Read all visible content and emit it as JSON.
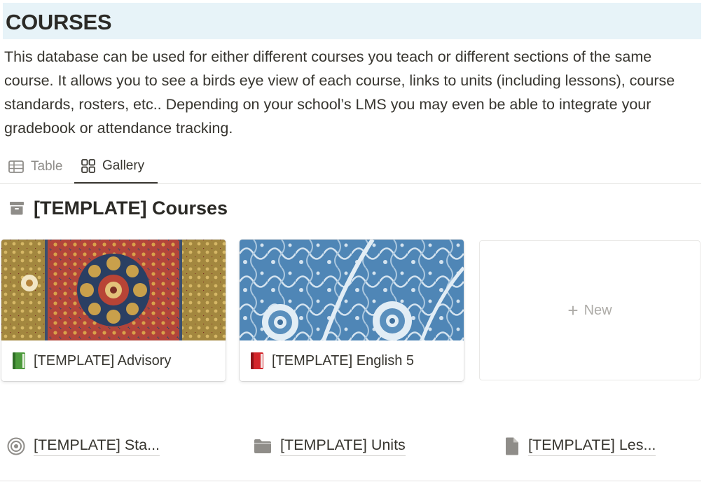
{
  "page": {
    "heading": "COURSES",
    "description": "This database can be used for either different courses you teach or different sections of the same course. It allows you to see a birds eye view of each course, links to units (including lessons), course standards, rosters, etc.. Depending on your school’s LMS you may even be able to integrate your gradebook or attendance tracking."
  },
  "views": {
    "tabs": [
      {
        "label": "Table",
        "icon": "table-icon",
        "active": false
      },
      {
        "label": "Gallery",
        "icon": "gallery-icon",
        "active": true
      }
    ]
  },
  "database": {
    "icon": "archive-box-icon",
    "title": "[TEMPLATE] Courses",
    "cards": [
      {
        "title": "[TEMPLATE] Advisory",
        "icon": "green-book-icon",
        "cover": "persian-carpet-pattern"
      },
      {
        "title": "[TEMPLATE] English 5",
        "icon": "red-book-icon",
        "cover": "blue-floral-pattern"
      }
    ],
    "new_label": "New"
  },
  "links": [
    {
      "label": "[TEMPLATE] Sta...",
      "icon": "target-icon"
    },
    {
      "label": "[TEMPLATE] Units",
      "icon": "folder-icon"
    },
    {
      "label": "[TEMPLATE] Les...",
      "icon": "document-icon"
    }
  ],
  "colors": {
    "heading_bg": "#e7f3f8",
    "text": "#37352f",
    "muted": "#8f8d89",
    "green_book": "#4c9a3c",
    "red_book": "#d3262b"
  }
}
